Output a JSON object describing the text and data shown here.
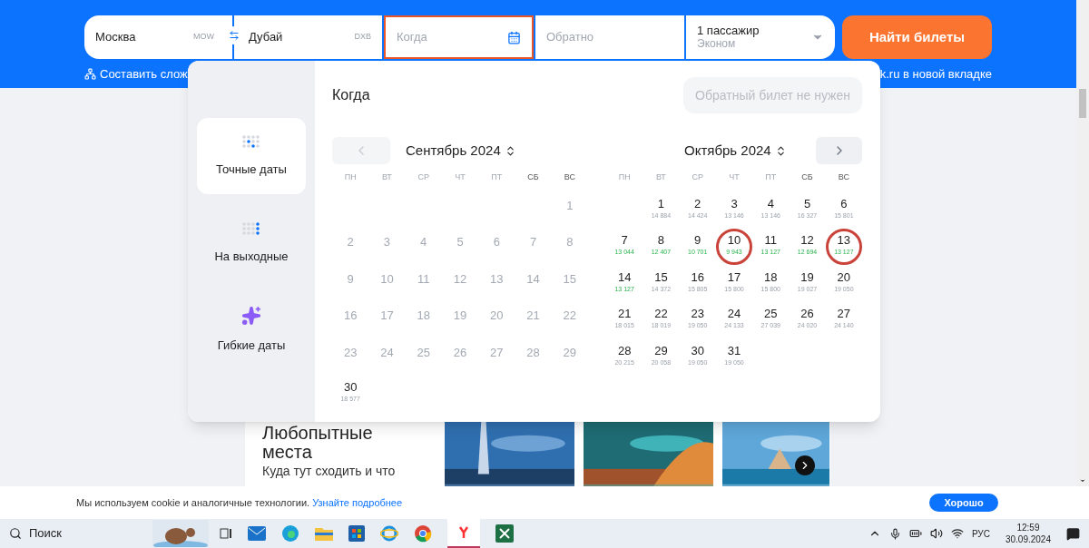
{
  "search_form": {
    "origin": {
      "value": "Москва",
      "code": "MOW"
    },
    "destination": {
      "value": "Дубай",
      "code": "DXB"
    },
    "depart": {
      "placeholder": "Когда",
      "focused": true
    },
    "return": {
      "placeholder": "Обратно",
      "focused": false
    },
    "passengers": {
      "count": "1 пассажир",
      "class": "Эконом"
    },
    "search_button": "Найти билеты"
  },
  "header_links": [
    "Составить слож",
    "k.ru в новой вкладке"
  ],
  "date_picker": {
    "modes": [
      {
        "kind": "exact",
        "label": "Точные даты",
        "selected": true
      },
      {
        "kind": "weekends",
        "label": "На выходные",
        "selected": false
      },
      {
        "kind": "flexible",
        "label": "Гибкие даты",
        "selected": false
      }
    ],
    "title": "Когда",
    "no_return_button": "Обратный билет не нужен",
    "months": [
      {
        "title": "Сентябрь 2024",
        "prev_button": true,
        "next_button": false,
        "weekdays": [
          {
            "label": "ПН",
            "weekend": false
          },
          {
            "label": "ВТ",
            "weekend": false
          },
          {
            "label": "СР",
            "weekend": false
          },
          {
            "label": "ЧТ",
            "weekend": false
          },
          {
            "label": "ПТ",
            "weekend": false
          },
          {
            "label": "СБ",
            "weekend": true
          },
          {
            "label": "ВС",
            "weekend": true
          }
        ],
        "days": [
          {
            "kind": "blank"
          },
          {
            "kind": "blank"
          },
          {
            "kind": "blank"
          },
          {
            "kind": "blank"
          },
          {
            "kind": "blank"
          },
          {
            "kind": "blank"
          },
          {
            "kind": "past",
            "day": "1"
          },
          {
            "kind": "past",
            "day": "2"
          },
          {
            "kind": "past",
            "day": "3"
          },
          {
            "kind": "past",
            "day": "4"
          },
          {
            "kind": "past",
            "day": "5"
          },
          {
            "kind": "past",
            "day": "6"
          },
          {
            "kind": "past",
            "day": "7"
          },
          {
            "kind": "past",
            "day": "8"
          },
          {
            "kind": "past",
            "day": "9"
          },
          {
            "kind": "past",
            "day": "10"
          },
          {
            "kind": "past",
            "day": "11"
          },
          {
            "kind": "past",
            "day": "12"
          },
          {
            "kind": "past",
            "day": "13"
          },
          {
            "kind": "past",
            "day": "14"
          },
          {
            "kind": "past",
            "day": "15"
          },
          {
            "kind": "past",
            "day": "16"
          },
          {
            "kind": "past",
            "day": "17"
          },
          {
            "kind": "past",
            "day": "18"
          },
          {
            "kind": "past",
            "day": "19"
          },
          {
            "kind": "past",
            "day": "20"
          },
          {
            "kind": "past",
            "day": "21"
          },
          {
            "kind": "past",
            "day": "22"
          },
          {
            "kind": "past",
            "day": "23"
          },
          {
            "kind": "past",
            "day": "24"
          },
          {
            "kind": "past",
            "day": "25"
          },
          {
            "kind": "past",
            "day": "26"
          },
          {
            "kind": "past",
            "day": "27"
          },
          {
            "kind": "past",
            "day": "28"
          },
          {
            "kind": "past",
            "day": "29"
          },
          {
            "kind": "available",
            "day": "30",
            "price": "18 577",
            "cheap": false,
            "circled": false
          }
        ]
      },
      {
        "title": "Октябрь 2024",
        "prev_button": false,
        "next_button": true,
        "weekdays": [
          {
            "label": "ПН",
            "weekend": false
          },
          {
            "label": "ВТ",
            "weekend": false
          },
          {
            "label": "СР",
            "weekend": false
          },
          {
            "label": "ЧТ",
            "weekend": false
          },
          {
            "label": "ПТ",
            "weekend": false
          },
          {
            "label": "СБ",
            "weekend": true
          },
          {
            "label": "ВС",
            "weekend": true
          }
        ],
        "days": [
          {
            "kind": "blank"
          },
          {
            "kind": "available",
            "day": "1",
            "price": "14 884",
            "cheap": false,
            "circled": false
          },
          {
            "kind": "available",
            "day": "2",
            "price": "14 424",
            "cheap": false,
            "circled": false
          },
          {
            "kind": "available",
            "day": "3",
            "price": "13 146",
            "cheap": false,
            "circled": false
          },
          {
            "kind": "available",
            "day": "4",
            "price": "13 146",
            "cheap": false,
            "circled": false
          },
          {
            "kind": "available",
            "day": "5",
            "price": "16 327",
            "cheap": false,
            "circled": false
          },
          {
            "kind": "available",
            "day": "6",
            "price": "15 801",
            "cheap": false,
            "circled": false
          },
          {
            "kind": "available",
            "day": "7",
            "price": "13 044",
            "cheap": true,
            "circled": false
          },
          {
            "kind": "available",
            "day": "8",
            "price": "12 407",
            "cheap": true,
            "circled": false
          },
          {
            "kind": "available",
            "day": "9",
            "price": "10 701",
            "cheap": true,
            "circled": false
          },
          {
            "kind": "available",
            "day": "10",
            "price": "9 943",
            "cheap": true,
            "circled": true
          },
          {
            "kind": "available",
            "day": "11",
            "price": "13 127",
            "cheap": true,
            "circled": false
          },
          {
            "kind": "available",
            "day": "12",
            "price": "12 694",
            "cheap": true,
            "circled": false
          },
          {
            "kind": "available",
            "day": "13",
            "price": "13 127",
            "cheap": true,
            "circled": true
          },
          {
            "kind": "available",
            "day": "14",
            "price": "13 127",
            "cheap": true,
            "circled": false
          },
          {
            "kind": "available",
            "day": "15",
            "price": "14 372",
            "cheap": false,
            "circled": false
          },
          {
            "kind": "available",
            "day": "16",
            "price": "15 805",
            "cheap": false,
            "circled": false
          },
          {
            "kind": "available",
            "day": "17",
            "price": "15 800",
            "cheap": false,
            "circled": false
          },
          {
            "kind": "available",
            "day": "18",
            "price": "15 800",
            "cheap": false,
            "circled": false
          },
          {
            "kind": "available",
            "day": "19",
            "price": "19 027",
            "cheap": false,
            "circled": false
          },
          {
            "kind": "available",
            "day": "20",
            "price": "19 050",
            "cheap": false,
            "circled": false
          },
          {
            "kind": "available",
            "day": "21",
            "price": "18 015",
            "cheap": false,
            "circled": false
          },
          {
            "kind": "available",
            "day": "22",
            "price": "18 019",
            "cheap": false,
            "circled": false
          },
          {
            "kind": "available",
            "day": "23",
            "price": "19 050",
            "cheap": false,
            "circled": false
          },
          {
            "kind": "available",
            "day": "24",
            "price": "24 133",
            "cheap": false,
            "circled": false
          },
          {
            "kind": "available",
            "day": "25",
            "price": "27 039",
            "cheap": false,
            "circled": false
          },
          {
            "kind": "available",
            "day": "26",
            "price": "24 020",
            "cheap": false,
            "circled": false
          },
          {
            "kind": "available",
            "day": "27",
            "price": "24 140",
            "cheap": false,
            "circled": false
          },
          {
            "kind": "available",
            "day": "28",
            "price": "20 215",
            "cheap": false,
            "circled": false
          },
          {
            "kind": "available",
            "day": "29",
            "price": "20 058",
            "cheap": false,
            "circled": false
          },
          {
            "kind": "available",
            "day": "30",
            "price": "19 050",
            "cheap": false,
            "circled": false
          },
          {
            "kind": "available",
            "day": "31",
            "price": "19 050",
            "cheap": false,
            "circled": false
          }
        ]
      }
    ]
  },
  "promo_card": {
    "title": "Любопытные места",
    "subtitle": "Куда тут сходить и что"
  },
  "cookie_bar": {
    "text": "Мы используем cookie и аналогичные технологии.",
    "link": "Узнайте подробнее",
    "button": "Хорошо"
  },
  "taskbar": {
    "search": "Поиск",
    "language": "РУС",
    "time": "12:59",
    "date": "30.09.2024"
  }
}
